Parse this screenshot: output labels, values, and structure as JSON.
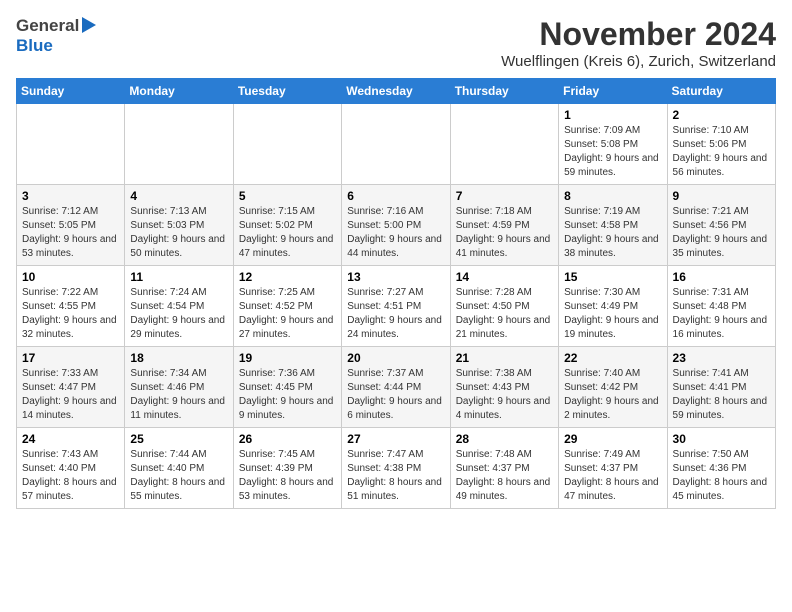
{
  "header": {
    "logo_general": "General",
    "logo_blue": "Blue",
    "title": "November 2024",
    "subtitle": "Wuelflingen (Kreis 6), Zurich, Switzerland"
  },
  "days_of_week": [
    "Sunday",
    "Monday",
    "Tuesday",
    "Wednesday",
    "Thursday",
    "Friday",
    "Saturday"
  ],
  "weeks": [
    [
      {
        "day": "",
        "info": ""
      },
      {
        "day": "",
        "info": ""
      },
      {
        "day": "",
        "info": ""
      },
      {
        "day": "",
        "info": ""
      },
      {
        "day": "",
        "info": ""
      },
      {
        "day": "1",
        "info": "Sunrise: 7:09 AM\nSunset: 5:08 PM\nDaylight: 9 hours and 59 minutes."
      },
      {
        "day": "2",
        "info": "Sunrise: 7:10 AM\nSunset: 5:06 PM\nDaylight: 9 hours and 56 minutes."
      }
    ],
    [
      {
        "day": "3",
        "info": "Sunrise: 7:12 AM\nSunset: 5:05 PM\nDaylight: 9 hours and 53 minutes."
      },
      {
        "day": "4",
        "info": "Sunrise: 7:13 AM\nSunset: 5:03 PM\nDaylight: 9 hours and 50 minutes."
      },
      {
        "day": "5",
        "info": "Sunrise: 7:15 AM\nSunset: 5:02 PM\nDaylight: 9 hours and 47 minutes."
      },
      {
        "day": "6",
        "info": "Sunrise: 7:16 AM\nSunset: 5:00 PM\nDaylight: 9 hours and 44 minutes."
      },
      {
        "day": "7",
        "info": "Sunrise: 7:18 AM\nSunset: 4:59 PM\nDaylight: 9 hours and 41 minutes."
      },
      {
        "day": "8",
        "info": "Sunrise: 7:19 AM\nSunset: 4:58 PM\nDaylight: 9 hours and 38 minutes."
      },
      {
        "day": "9",
        "info": "Sunrise: 7:21 AM\nSunset: 4:56 PM\nDaylight: 9 hours and 35 minutes."
      }
    ],
    [
      {
        "day": "10",
        "info": "Sunrise: 7:22 AM\nSunset: 4:55 PM\nDaylight: 9 hours and 32 minutes."
      },
      {
        "day": "11",
        "info": "Sunrise: 7:24 AM\nSunset: 4:54 PM\nDaylight: 9 hours and 29 minutes."
      },
      {
        "day": "12",
        "info": "Sunrise: 7:25 AM\nSunset: 4:52 PM\nDaylight: 9 hours and 27 minutes."
      },
      {
        "day": "13",
        "info": "Sunrise: 7:27 AM\nSunset: 4:51 PM\nDaylight: 9 hours and 24 minutes."
      },
      {
        "day": "14",
        "info": "Sunrise: 7:28 AM\nSunset: 4:50 PM\nDaylight: 9 hours and 21 minutes."
      },
      {
        "day": "15",
        "info": "Sunrise: 7:30 AM\nSunset: 4:49 PM\nDaylight: 9 hours and 19 minutes."
      },
      {
        "day": "16",
        "info": "Sunrise: 7:31 AM\nSunset: 4:48 PM\nDaylight: 9 hours and 16 minutes."
      }
    ],
    [
      {
        "day": "17",
        "info": "Sunrise: 7:33 AM\nSunset: 4:47 PM\nDaylight: 9 hours and 14 minutes."
      },
      {
        "day": "18",
        "info": "Sunrise: 7:34 AM\nSunset: 4:46 PM\nDaylight: 9 hours and 11 minutes."
      },
      {
        "day": "19",
        "info": "Sunrise: 7:36 AM\nSunset: 4:45 PM\nDaylight: 9 hours and 9 minutes."
      },
      {
        "day": "20",
        "info": "Sunrise: 7:37 AM\nSunset: 4:44 PM\nDaylight: 9 hours and 6 minutes."
      },
      {
        "day": "21",
        "info": "Sunrise: 7:38 AM\nSunset: 4:43 PM\nDaylight: 9 hours and 4 minutes."
      },
      {
        "day": "22",
        "info": "Sunrise: 7:40 AM\nSunset: 4:42 PM\nDaylight: 9 hours and 2 minutes."
      },
      {
        "day": "23",
        "info": "Sunrise: 7:41 AM\nSunset: 4:41 PM\nDaylight: 8 hours and 59 minutes."
      }
    ],
    [
      {
        "day": "24",
        "info": "Sunrise: 7:43 AM\nSunset: 4:40 PM\nDaylight: 8 hours and 57 minutes."
      },
      {
        "day": "25",
        "info": "Sunrise: 7:44 AM\nSunset: 4:40 PM\nDaylight: 8 hours and 55 minutes."
      },
      {
        "day": "26",
        "info": "Sunrise: 7:45 AM\nSunset: 4:39 PM\nDaylight: 8 hours and 53 minutes."
      },
      {
        "day": "27",
        "info": "Sunrise: 7:47 AM\nSunset: 4:38 PM\nDaylight: 8 hours and 51 minutes."
      },
      {
        "day": "28",
        "info": "Sunrise: 7:48 AM\nSunset: 4:37 PM\nDaylight: 8 hours and 49 minutes."
      },
      {
        "day": "29",
        "info": "Sunrise: 7:49 AM\nSunset: 4:37 PM\nDaylight: 8 hours and 47 minutes."
      },
      {
        "day": "30",
        "info": "Sunrise: 7:50 AM\nSunset: 4:36 PM\nDaylight: 8 hours and 45 minutes."
      }
    ]
  ]
}
